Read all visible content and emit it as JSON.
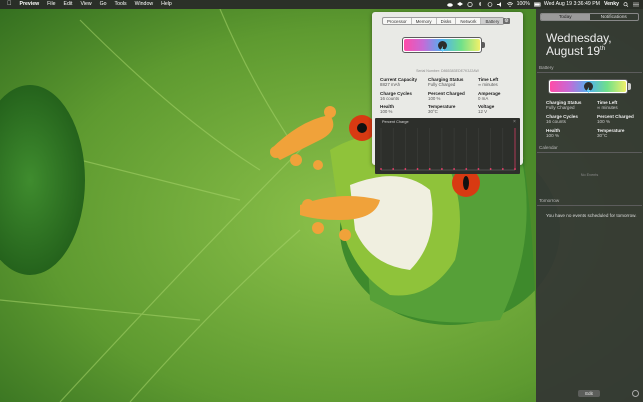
{
  "menubar": {
    "app": "Preview",
    "menus": [
      "File",
      "Edit",
      "View",
      "Go",
      "Tools",
      "Window",
      "Help"
    ],
    "battery_percent": "100%",
    "clock": "Wed Aug 19  3:36:49 PM",
    "user": "Venky"
  },
  "panel": {
    "tabs": [
      "Processor",
      "Memory",
      "Disks",
      "Network",
      "Battery"
    ],
    "active_tab": "Battery",
    "serial": "Serial Number: D865383EDE7K3J2AW",
    "stats": {
      "current_capacity": {
        "label": "Current Capacity",
        "value": "8827 mAh"
      },
      "charging_status": {
        "label": "Charging Status",
        "value": "Fully Charged"
      },
      "time_left": {
        "label": "Time Left",
        "value": "∞ minutes"
      },
      "charge_cycles": {
        "label": "Charge Cycles",
        "value": "16 counts"
      },
      "percent_charged": {
        "label": "Percent Charged",
        "value": "100 %"
      },
      "amperage": {
        "label": "Amperage",
        "value": "0 mA"
      },
      "health": {
        "label": "Health",
        "value": "100 %"
      },
      "temperature": {
        "label": "Temperature",
        "value": "30°C"
      },
      "voltage": {
        "label": "Voltage",
        "value": "12 V"
      }
    },
    "chart": {
      "title": "Percent Charge",
      "points": [
        100,
        100,
        100,
        100,
        100,
        100,
        100,
        100,
        100,
        100,
        100,
        100
      ]
    },
    "battery_level": 1.0
  },
  "notification_center": {
    "tabs": [
      "Today",
      "Notifications"
    ],
    "active_tab": "Today",
    "day": "Wednesday,",
    "date": "August 19",
    "date_suffix": "th",
    "battery_section": "Battery",
    "battery_stats": {
      "charging_status": {
        "label": "Charging Status",
        "value": "Fully Charged"
      },
      "time_left": {
        "label": "Time Left",
        "value": "∞ minutes"
      },
      "charge_cycles": {
        "label": "Charge Cycles",
        "value": "16 counts"
      },
      "percent_charged": {
        "label": "Percent Charged",
        "value": "100 %"
      },
      "health": {
        "label": "Health",
        "value": "100 %"
      },
      "temperature": {
        "label": "Temperature",
        "value": "30°C"
      }
    },
    "calendar_section": "Calendar",
    "no_events": "No Events",
    "tomorrow_section": "Tomorrow",
    "tomorrow_msg": "You have no events scheduled for tomorrow.",
    "edit_label": "Edit"
  }
}
